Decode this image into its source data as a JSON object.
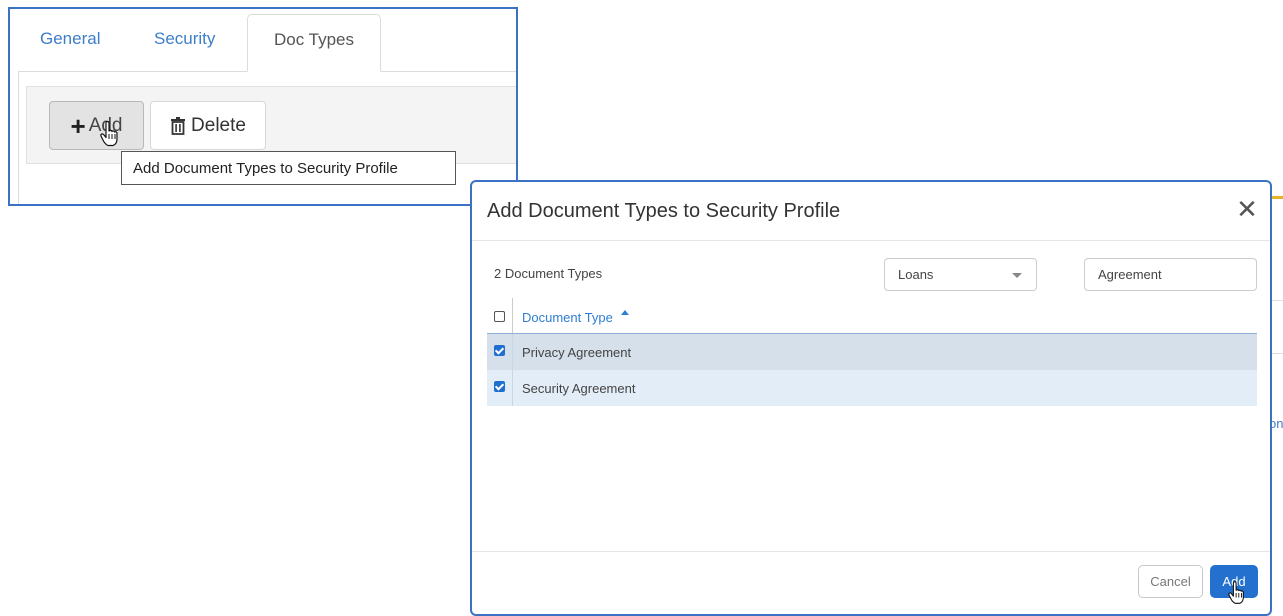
{
  "tabs": {
    "general": "General",
    "security": "Security",
    "doc_types": "Doc Types",
    "active": "Doc Types"
  },
  "toolbar": {
    "add_label": "Add",
    "add_icon": "plus-icon",
    "delete_label": "Delete",
    "delete_icon": "trash-icon"
  },
  "tooltip": "Add Document Types to Security Profile",
  "background": {
    "fragment": "on"
  },
  "modal": {
    "title": "Add Document Types to Security Profile",
    "close_icon": "close-icon",
    "count_label": "2 Document Types",
    "category_select": "Loans",
    "filter_value": "Agreement",
    "grid": {
      "column": "Document Type",
      "sort": "ascending",
      "select_all_checked": false,
      "rows": [
        {
          "name": "Privacy Agreement",
          "checked": true
        },
        {
          "name": "Security Agreement",
          "checked": true
        }
      ]
    },
    "cancel_label": "Cancel",
    "add_label": "Add"
  },
  "colors": {
    "accent": "#2470cf",
    "link": "#3d7ec9",
    "highlight_border": "#3b72c4",
    "row_selected": "#d5e0eb",
    "row_alt": "#e3edf7"
  }
}
